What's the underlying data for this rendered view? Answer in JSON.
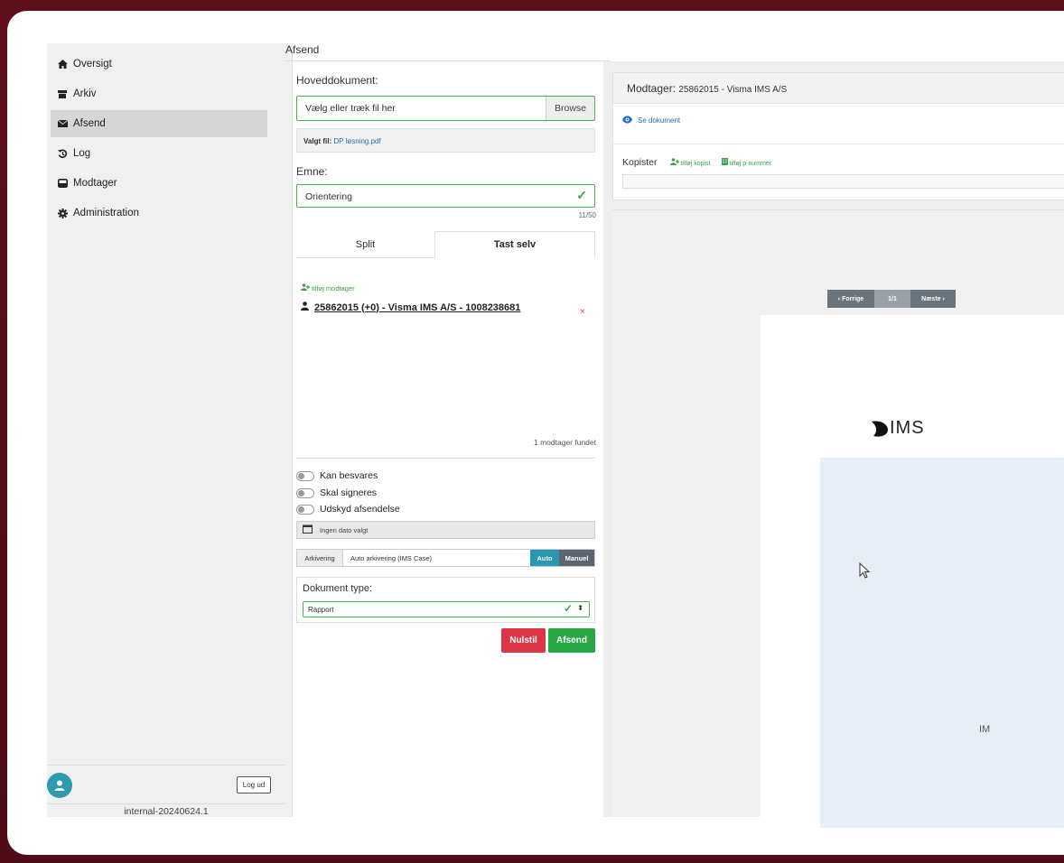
{
  "sidebar": {
    "items": [
      {
        "label": "Oversigt",
        "icon": "home-icon"
      },
      {
        "label": "Arkiv",
        "icon": "archive-icon"
      },
      {
        "label": "Afsend",
        "icon": "envelope-icon",
        "active": true
      },
      {
        "label": "Log",
        "icon": "history-icon"
      },
      {
        "label": "Modtager",
        "icon": "inbox-icon"
      },
      {
        "label": "Administration",
        "icon": "cog-icon"
      }
    ],
    "logout_label": "Log ud",
    "version": "internal-20240624.1"
  },
  "form": {
    "header": "Afsend",
    "main_doc_label": "Hoveddokument:",
    "file_placeholder": "Vælg eller træk fil her",
    "browse_label": "Browse",
    "selected_prefix": "Valgt fil:",
    "selected_file": "DP løsning.pdf",
    "subject_label": "Emne:",
    "subject_value": "Orientering",
    "subject_counter": "11/50",
    "tabs": [
      "Split",
      "Tast selv"
    ],
    "active_tab": "Tast selv",
    "add_recipient": "tilføj modtager",
    "recipient": "25862015 (+0) - Visma IMS A/S - 1008238681",
    "remove_symbol": "×",
    "found_text": "1 modtager fundet",
    "toggles": [
      {
        "label": "Kan besvares",
        "on": false
      },
      {
        "label": "Skal signeres",
        "on": false
      },
      {
        "label": "Udskyd afsendelse",
        "on": false
      }
    ],
    "date_placeholder": "Ingen dato valgt",
    "archiving_tag": "Arkivering",
    "archiving_value": "Auto arkivering (IMS Case)",
    "archiving_auto": "Auto",
    "archiving_manual": "Manuel",
    "doctype_label": "Dokument type:",
    "doctype_value": "Rapport",
    "reset_label": "Nulstil",
    "send_label": "Afsend"
  },
  "preview": {
    "recipient_prefix": "Modtager:",
    "recipient_value": "25862015 - Visma IMS A/S",
    "see_document": "Se dokument",
    "copies_label": "Kopister",
    "add_copy": "tilføj kopist",
    "add_pnumber": "tilføj p-nummer",
    "prev_label": "Forrige",
    "page_indicator": "1/1",
    "next_label": "Næste",
    "logo_text": "IMS",
    "page_text_fragment": "IM"
  },
  "colors": {
    "background": "#5a0e1a",
    "accent_green": "#28a745",
    "danger": "#dc3545",
    "auto_teal": "#2897b2",
    "link_blue": "#1e6fbf"
  }
}
